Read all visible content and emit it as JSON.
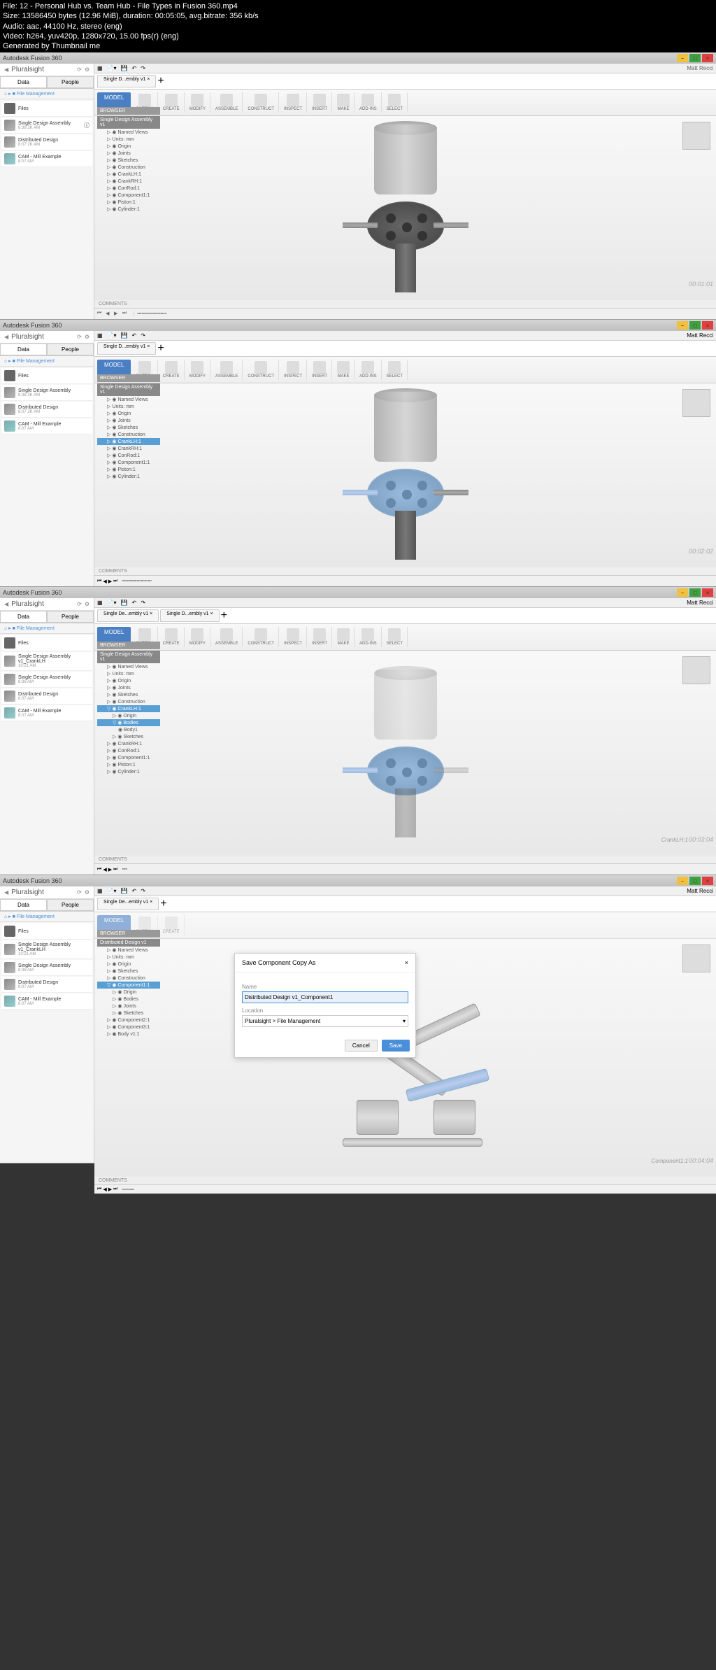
{
  "fileInfo": {
    "file": "File: 12 - Personal Hub vs. Team Hub - File Types in Fusion 360.mp4",
    "size": "Size: 13586450 bytes (12.96 MiB), duration: 00:05:05, avg.bitrate: 356 kb/s",
    "audio": "Audio: aac, 44100 Hz, stereo (eng)",
    "video": "Video: h264, yuv420p, 1280x720, 15.00 fps(r) (eng)",
    "generated": "Generated by Thumbnail me"
  },
  "app": {
    "title": "Autodesk Fusion 360"
  },
  "sidebar": {
    "brand": "Pluralsight",
    "tabs": {
      "data": "Data",
      "people": "People"
    },
    "breadcrumb": "File Management"
  },
  "files1": [
    {
      "name": "Files",
      "meta": ""
    },
    {
      "name": "Single Design Assembly",
      "meta": "8:38 2K AM"
    },
    {
      "name": "Distributed Design",
      "meta": "8:07 2K AM"
    },
    {
      "name": "CAM - Mill Example",
      "meta": "8:07 AM"
    }
  ],
  "files3": [
    {
      "name": "Files",
      "meta": ""
    },
    {
      "name": "Single Design Assembly v1_CrankLH",
      "meta": "10:21 AM"
    },
    {
      "name": "Single Design Assembly",
      "meta": "8:38 AM"
    },
    {
      "name": "Distributed Design",
      "meta": "8:07 AM"
    },
    {
      "name": "CAM - Mill Example",
      "meta": "8:07 AM"
    }
  ],
  "docTabs": {
    "tab1": "Single D...embly v1",
    "tab2": "Single De...embly v1"
  },
  "ribbon": {
    "model": "MODEL",
    "sketch": "SKETCH",
    "create": "CREATE",
    "modify": "MODIFY",
    "assemble": "ASSEMBLE",
    "construct": "CONSTRUCT",
    "inspect": "INSPECT",
    "insert": "INSERT",
    "make": "MAKE",
    "addins": "ADD-INS",
    "select": "SELECT"
  },
  "browser": {
    "header": "BROWSER",
    "root": "Single Design Assembly v1",
    "items": [
      "Named Views",
      "Units: mm",
      "Origin",
      "Joints",
      "Sketches",
      "Construction",
      "CrankLH:1",
      "CrankRH:1",
      "ConRod:1",
      "Component1:1",
      "Piston:1",
      "Cylinder:1"
    ]
  },
  "browser4": {
    "root": "Distributed Design v1",
    "items": [
      "Named Views",
      "Units: mm",
      "Origin",
      "Sketches",
      "Construction",
      "Component1:1",
      "Origin",
      "Bodies",
      "Joints",
      "Sketches",
      "Component2:1",
      "Component3:1",
      "Body v1:1"
    ]
  },
  "timestamps": {
    "t1": "00:01:01",
    "t2": "00:02:02",
    "t3": "00:03:04",
    "t4": "00:04:04"
  },
  "dialog": {
    "title": "Save Component Copy As",
    "nameLabel": "Name",
    "nameValue": "Distributed Design v1_Component1",
    "locationLabel": "Location",
    "locationValue": "Pluralsight > File Management",
    "cancel": "Cancel",
    "save": "Save"
  },
  "status": {
    "user": "Matt Recci",
    "comments": "COMMENTS",
    "component": "Component1:1"
  }
}
